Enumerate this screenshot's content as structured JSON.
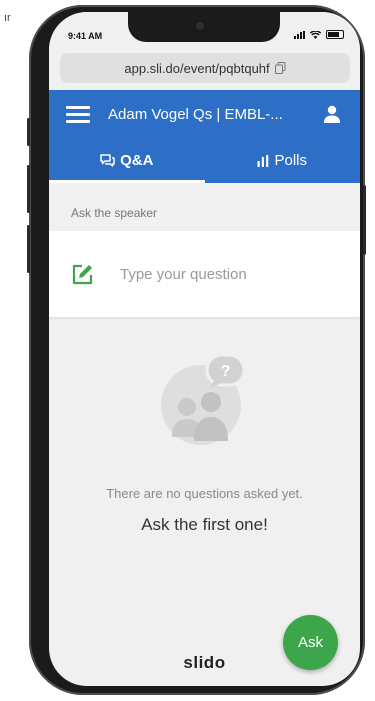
{
  "status_bar": {
    "time": "9:41 AM"
  },
  "browser": {
    "url": "app.sli.do/event/pqbtquhf"
  },
  "header": {
    "title": "Adam Vogel Qs | EMBL-..."
  },
  "tabs": [
    {
      "label": "Q&A",
      "icon": "chat-icon",
      "active": true
    },
    {
      "label": "Polls",
      "icon": "bar-chart-icon",
      "active": false
    }
  ],
  "ask": {
    "section_label": "Ask the speaker",
    "placeholder": "Type your question"
  },
  "empty_state": {
    "message": "There are no questions asked yet.",
    "cta": "Ask the first one!"
  },
  "fab": {
    "label": "Ask"
  },
  "footer": {
    "brand": "slido"
  },
  "colors": {
    "accent": "#2d6fc6",
    "ask_button": "#3ea64a",
    "edit_icon": "#3ea64a"
  },
  "corner_mark": "ır"
}
